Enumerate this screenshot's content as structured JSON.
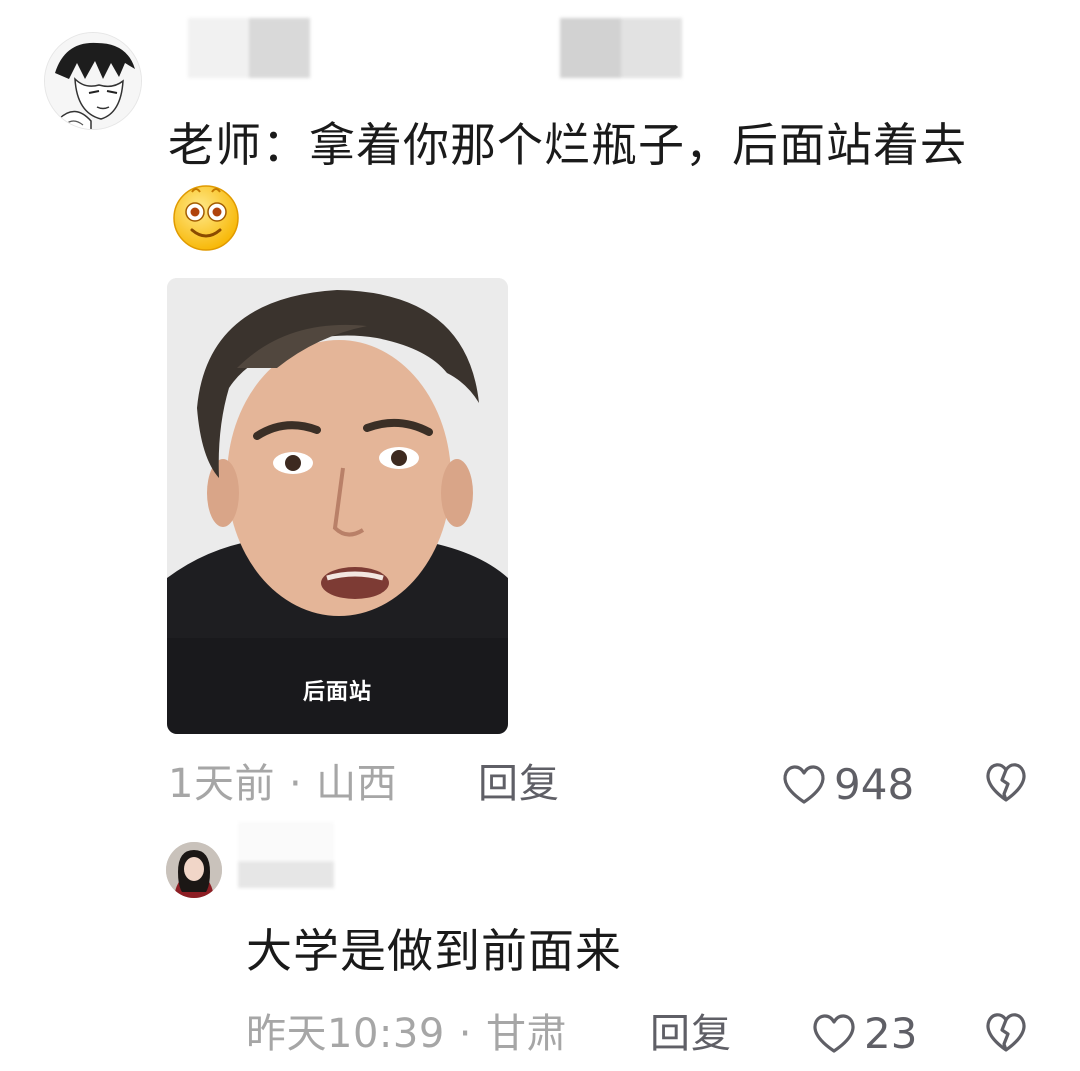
{
  "comment": {
    "text": "老师：拿着你那个烂瓶子，后面站着去",
    "emoji": "smiling-face-emoji",
    "media_caption": "后面站",
    "time": "1天前",
    "location": "山西",
    "separator": "·",
    "reply_label": "回复",
    "like_count": "948"
  },
  "reply": {
    "text": "大学是做到前面来",
    "time": "昨天10:39",
    "location": "甘肃",
    "separator": "·",
    "reply_label": "回复",
    "like_count": "23"
  },
  "colors": {
    "meta_gray": "#a6a6a6",
    "action_gray": "#5f5f66",
    "text": "#1a1a1a"
  }
}
